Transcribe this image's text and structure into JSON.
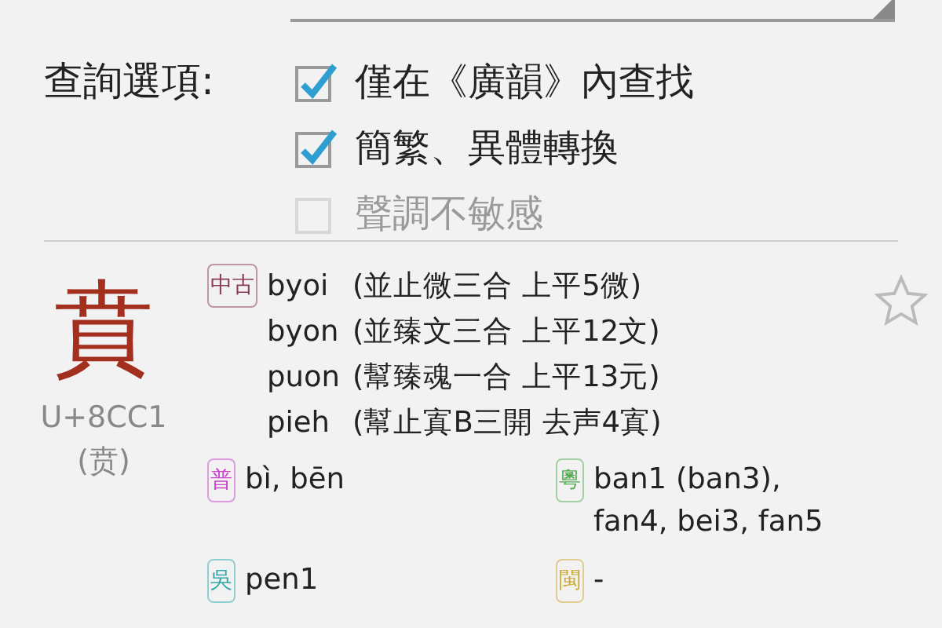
{
  "query_options": {
    "label": "查詢選項:",
    "options": [
      {
        "label": "僅在《廣韻》內查找",
        "checked": true,
        "disabled": false
      },
      {
        "label": "簡繁、異體轉換",
        "checked": true,
        "disabled": false
      },
      {
        "label": "聲調不敏感",
        "checked": false,
        "disabled": true
      }
    ]
  },
  "entry": {
    "character": "賁",
    "codepoint": "U+8CC1",
    "simplified": "(贲)",
    "starred": false,
    "middle_chinese": {
      "badge": "中古",
      "color": "#8a3a5a",
      "readings": [
        {
          "romanization": "byoi",
          "description": "(並止微三合 上平5微)"
        },
        {
          "romanization": "byon",
          "description": "(並臻文三合 上平12文)"
        },
        {
          "romanization": "puon",
          "description": "(幫臻魂一合 上平13元)"
        },
        {
          "romanization": "pieh",
          "description": "(幫止寘B三開 去声4寘)"
        }
      ]
    },
    "dialects": [
      {
        "badge": "普",
        "color": "#cc44cc",
        "reading": "bì, bēn"
      },
      {
        "badge": "粵",
        "color": "#55aa55",
        "reading": "ban1 (ban3), fan4, bei3, fan5"
      },
      {
        "badge": "吳",
        "color": "#33aaaa",
        "reading": "pen1"
      },
      {
        "badge": "閩",
        "color": "#ccaa33",
        "reading": "-"
      }
    ]
  }
}
